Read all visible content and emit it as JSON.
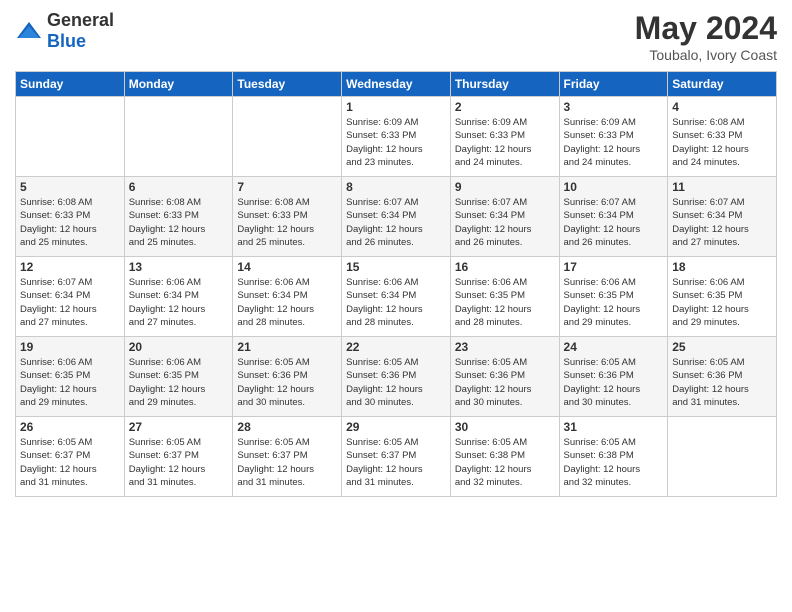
{
  "logo": {
    "general": "General",
    "blue": "Blue"
  },
  "header": {
    "month_year": "May 2024",
    "location": "Toubalo, Ivory Coast"
  },
  "weekdays": [
    "Sunday",
    "Monday",
    "Tuesday",
    "Wednesday",
    "Thursday",
    "Friday",
    "Saturday"
  ],
  "weeks": [
    [
      {
        "day": "",
        "info": ""
      },
      {
        "day": "",
        "info": ""
      },
      {
        "day": "",
        "info": ""
      },
      {
        "day": "1",
        "info": "Sunrise: 6:09 AM\nSunset: 6:33 PM\nDaylight: 12 hours\nand 23 minutes."
      },
      {
        "day": "2",
        "info": "Sunrise: 6:09 AM\nSunset: 6:33 PM\nDaylight: 12 hours\nand 24 minutes."
      },
      {
        "day": "3",
        "info": "Sunrise: 6:09 AM\nSunset: 6:33 PM\nDaylight: 12 hours\nand 24 minutes."
      },
      {
        "day": "4",
        "info": "Sunrise: 6:08 AM\nSunset: 6:33 PM\nDaylight: 12 hours\nand 24 minutes."
      }
    ],
    [
      {
        "day": "5",
        "info": "Sunrise: 6:08 AM\nSunset: 6:33 PM\nDaylight: 12 hours\nand 25 minutes."
      },
      {
        "day": "6",
        "info": "Sunrise: 6:08 AM\nSunset: 6:33 PM\nDaylight: 12 hours\nand 25 minutes."
      },
      {
        "day": "7",
        "info": "Sunrise: 6:08 AM\nSunset: 6:33 PM\nDaylight: 12 hours\nand 25 minutes."
      },
      {
        "day": "8",
        "info": "Sunrise: 6:07 AM\nSunset: 6:34 PM\nDaylight: 12 hours\nand 26 minutes."
      },
      {
        "day": "9",
        "info": "Sunrise: 6:07 AM\nSunset: 6:34 PM\nDaylight: 12 hours\nand 26 minutes."
      },
      {
        "day": "10",
        "info": "Sunrise: 6:07 AM\nSunset: 6:34 PM\nDaylight: 12 hours\nand 26 minutes."
      },
      {
        "day": "11",
        "info": "Sunrise: 6:07 AM\nSunset: 6:34 PM\nDaylight: 12 hours\nand 27 minutes."
      }
    ],
    [
      {
        "day": "12",
        "info": "Sunrise: 6:07 AM\nSunset: 6:34 PM\nDaylight: 12 hours\nand 27 minutes."
      },
      {
        "day": "13",
        "info": "Sunrise: 6:06 AM\nSunset: 6:34 PM\nDaylight: 12 hours\nand 27 minutes."
      },
      {
        "day": "14",
        "info": "Sunrise: 6:06 AM\nSunset: 6:34 PM\nDaylight: 12 hours\nand 28 minutes."
      },
      {
        "day": "15",
        "info": "Sunrise: 6:06 AM\nSunset: 6:34 PM\nDaylight: 12 hours\nand 28 minutes."
      },
      {
        "day": "16",
        "info": "Sunrise: 6:06 AM\nSunset: 6:35 PM\nDaylight: 12 hours\nand 28 minutes."
      },
      {
        "day": "17",
        "info": "Sunrise: 6:06 AM\nSunset: 6:35 PM\nDaylight: 12 hours\nand 29 minutes."
      },
      {
        "day": "18",
        "info": "Sunrise: 6:06 AM\nSunset: 6:35 PM\nDaylight: 12 hours\nand 29 minutes."
      }
    ],
    [
      {
        "day": "19",
        "info": "Sunrise: 6:06 AM\nSunset: 6:35 PM\nDaylight: 12 hours\nand 29 minutes."
      },
      {
        "day": "20",
        "info": "Sunrise: 6:06 AM\nSunset: 6:35 PM\nDaylight: 12 hours\nand 29 minutes."
      },
      {
        "day": "21",
        "info": "Sunrise: 6:05 AM\nSunset: 6:36 PM\nDaylight: 12 hours\nand 30 minutes."
      },
      {
        "day": "22",
        "info": "Sunrise: 6:05 AM\nSunset: 6:36 PM\nDaylight: 12 hours\nand 30 minutes."
      },
      {
        "day": "23",
        "info": "Sunrise: 6:05 AM\nSunset: 6:36 PM\nDaylight: 12 hours\nand 30 minutes."
      },
      {
        "day": "24",
        "info": "Sunrise: 6:05 AM\nSunset: 6:36 PM\nDaylight: 12 hours\nand 30 minutes."
      },
      {
        "day": "25",
        "info": "Sunrise: 6:05 AM\nSunset: 6:36 PM\nDaylight: 12 hours\nand 31 minutes."
      }
    ],
    [
      {
        "day": "26",
        "info": "Sunrise: 6:05 AM\nSunset: 6:37 PM\nDaylight: 12 hours\nand 31 minutes."
      },
      {
        "day": "27",
        "info": "Sunrise: 6:05 AM\nSunset: 6:37 PM\nDaylight: 12 hours\nand 31 minutes."
      },
      {
        "day": "28",
        "info": "Sunrise: 6:05 AM\nSunset: 6:37 PM\nDaylight: 12 hours\nand 31 minutes."
      },
      {
        "day": "29",
        "info": "Sunrise: 6:05 AM\nSunset: 6:37 PM\nDaylight: 12 hours\nand 31 minutes."
      },
      {
        "day": "30",
        "info": "Sunrise: 6:05 AM\nSunset: 6:38 PM\nDaylight: 12 hours\nand 32 minutes."
      },
      {
        "day": "31",
        "info": "Sunrise: 6:05 AM\nSunset: 6:38 PM\nDaylight: 12 hours\nand 32 minutes."
      },
      {
        "day": "",
        "info": ""
      }
    ]
  ]
}
